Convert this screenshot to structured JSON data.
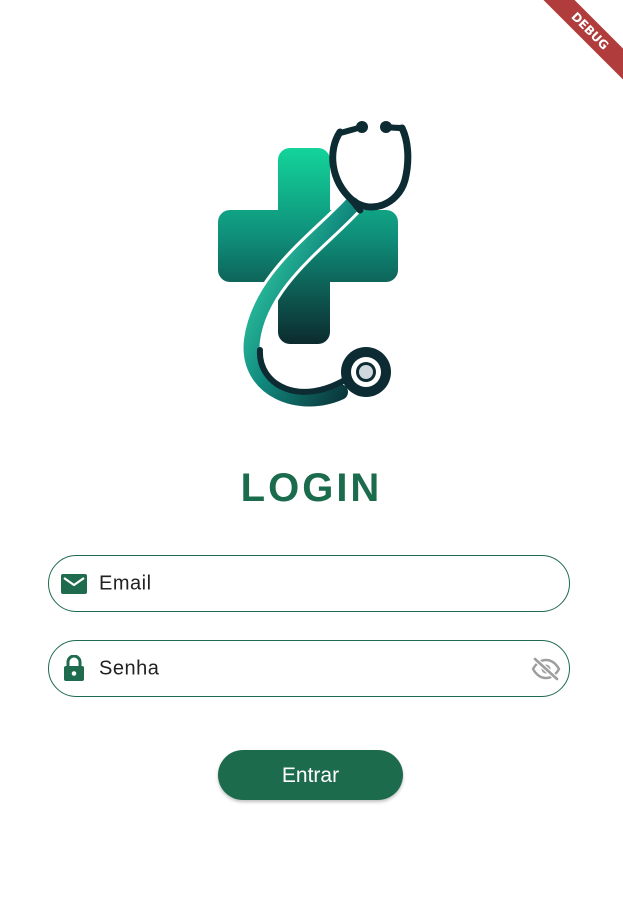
{
  "debug_banner": {
    "label": "DEBUG"
  },
  "logo": {
    "icon": "medical-cross-stethoscope-logo"
  },
  "title": "LOGIN",
  "form": {
    "email": {
      "label": "Email",
      "icon": "email-icon"
    },
    "password": {
      "label": "Senha",
      "icon": "lock-icon",
      "toggle_icon": "visibility-off-icon"
    },
    "submit_label": "Entrar"
  },
  "colors": {
    "primary": "#1d6b4d",
    "title": "#1b6b4d",
    "debug": "#b13c3c",
    "background": "#ffffff"
  }
}
